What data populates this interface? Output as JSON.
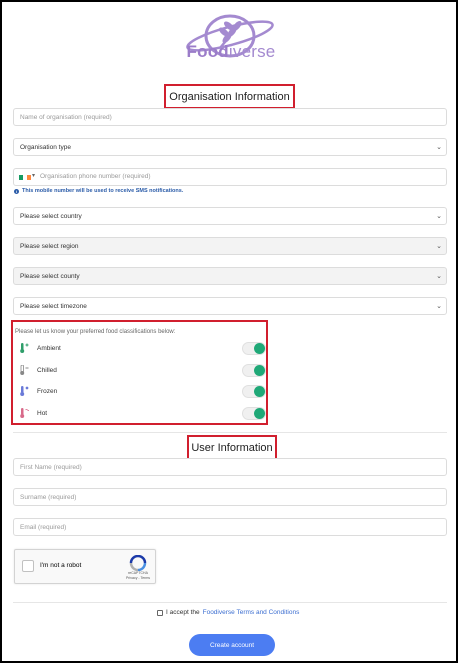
{
  "brand": {
    "name_bold": "Food",
    "name_light": "iverse"
  },
  "org_section": {
    "title": "Organisation Information"
  },
  "org_fields": {
    "name_placeholder": "Name of organisation (required)",
    "type_value": "Organisation type",
    "phone_placeholder": "Organisation phone number (required)",
    "phone_note": "This mobile number will be used to receive SMS notifications.",
    "country_value": "Please select country",
    "region_value": "Please select region",
    "county_value": "Please select county",
    "timezone_value": "Please select timezone"
  },
  "classifications": {
    "prompt": "Please let us know your preferred food classifications below:",
    "items": [
      {
        "label": "Ambient",
        "icon": "ambient-thermometer-icon",
        "enabled": true
      },
      {
        "label": "Chilled",
        "icon": "chilled-thermometer-icon",
        "enabled": true
      },
      {
        "label": "Frozen",
        "icon": "frozen-thermometer-icon",
        "enabled": true
      },
      {
        "label": "Hot",
        "icon": "hot-thermometer-icon",
        "enabled": true
      }
    ]
  },
  "user_section": {
    "title": "User Information"
  },
  "user_fields": {
    "first_name_placeholder": "First Name (required)",
    "surname_placeholder": "Surname (required)",
    "email_placeholder": "Email (required)"
  },
  "captcha": {
    "label": "I'm not a robot",
    "brand": "reCAPTCHA",
    "links": "Privacy - Terms"
  },
  "terms": {
    "prefix": "I accept the",
    "link": "Foodiverse Terms and Conditions"
  },
  "submit": {
    "label": "Create account"
  },
  "colors": {
    "brand": "#9b7cc9",
    "toggle_on": "#1fa877",
    "primary": "#4c7df2",
    "highlight": "#d11f2e",
    "link": "#3d6fd1"
  }
}
